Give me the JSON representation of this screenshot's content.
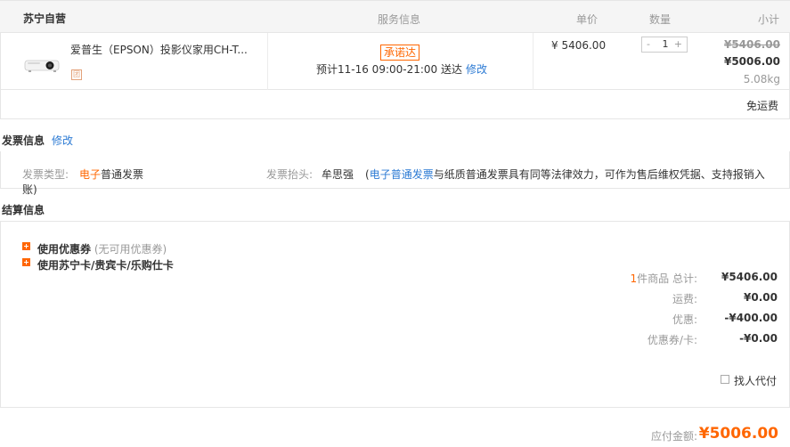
{
  "order": {
    "shop_name": "苏宁自营",
    "columns": {
      "service": "服务信息",
      "unit_price": "单价",
      "quantity": "数量",
      "subtotal": "小计"
    }
  },
  "item": {
    "name": "爱普生（EPSON）投影仪家用CH-T...",
    "tuan_label": "团",
    "promise_badge": "承诺达",
    "delivery_text": "预计11-16 09:00-21:00 送达",
    "delivery_modify": "修改",
    "unit_price": "¥ 5406.00",
    "qty_minus": "-",
    "qty_value": "1",
    "qty_plus": "+",
    "original_subtotal": "¥5406.00",
    "final_subtotal": "¥5006.00",
    "weight": "5.08kg"
  },
  "shipping": {
    "label": "免运费"
  },
  "invoice": {
    "title": "发票信息",
    "modify": "修改",
    "type_label": "发票类型:",
    "type_value_highlight": "电子",
    "type_value_rest": "普通发票",
    "header_label": "发票抬头:",
    "header_value": "牟思强",
    "note_open": "(",
    "note_link": "电子普通发票",
    "note_text": "与纸质普通发票具有同等法律效力，可作为售后维权凭据、支持报销入",
    "note_wrap": "账)"
  },
  "settlement": {
    "title": "结算信息",
    "coupon_label": "使用优惠券",
    "coupon_hint": "(无可用优惠券)",
    "card_label": "使用苏宁卡/贵宾卡/乐购仕卡",
    "count": "1",
    "goods_total_label": "件商品 总计:",
    "goods_total_value": "¥5406.00",
    "freight_label": "运费:",
    "freight_value": "¥0.00",
    "discount_label": "优惠:",
    "discount_value": "-¥400.00",
    "coupon_card_label": "优惠券/卡:",
    "coupon_card_value": "-¥0.00",
    "pay_by_other": "找人代付"
  },
  "payable": {
    "label": "应付金额:",
    "value": "¥5006.00"
  },
  "colors": {
    "accent": "#ff6600",
    "link": "#2d7bd4",
    "border": "#e6e6e6"
  }
}
